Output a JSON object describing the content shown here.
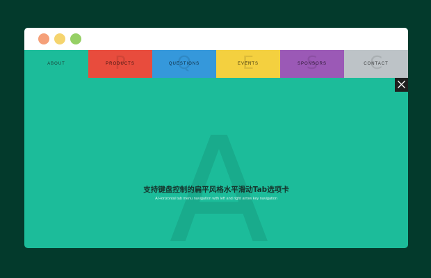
{
  "window": {
    "title_dots": [
      {
        "name": "close",
        "color": "#f5a079"
      },
      {
        "name": "minimize",
        "color": "#f5d46e"
      },
      {
        "name": "maximize",
        "color": "#96d065"
      }
    ],
    "background": "#1cbc9a"
  },
  "tabs": [
    {
      "label": "ABOUT",
      "letter": "A",
      "color": "#1cbc9a",
      "active": true
    },
    {
      "label": "PRODUCTS",
      "letter": "P",
      "color": "#e84c3d",
      "active": false
    },
    {
      "label": "QUESTIONS",
      "letter": "Q",
      "color": "#3598db",
      "active": false
    },
    {
      "label": "EVENTS",
      "letter": "E",
      "color": "#f4d03f",
      "active": false
    },
    {
      "label": "SPONSORS",
      "letter": "S",
      "color": "#9b59b6",
      "active": false
    },
    {
      "label": "CONTACT",
      "letter": "C",
      "color": "#bdc3c7",
      "active": false
    }
  ],
  "content": {
    "big_letter": "A",
    "headline": "支持键盘控制的扁平风格水平滑动Tab选项卡",
    "subline": "A Horizontal tab menu navigation with left and right arrow key navigation"
  },
  "close_button": {
    "icon": "close-icon"
  }
}
